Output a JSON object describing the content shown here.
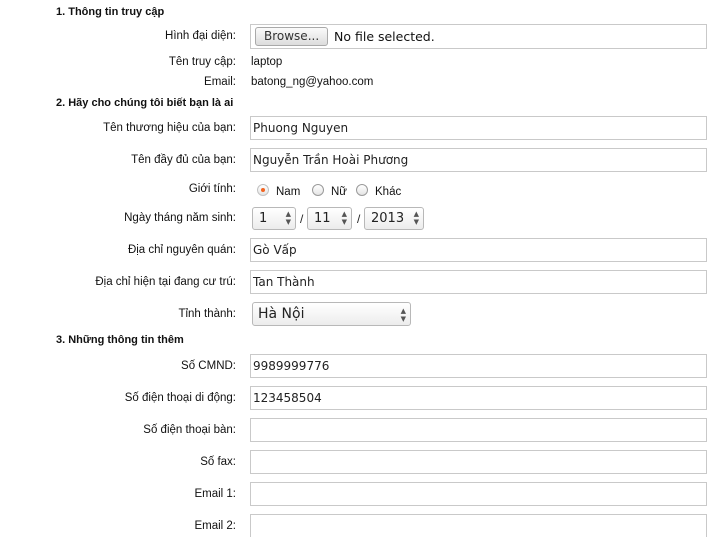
{
  "sections": {
    "access": "1. Thông tin truy cập",
    "about": "2. Hãy cho chúng tôi biết bạn là ai",
    "extra": "3. Những thông tin thêm"
  },
  "access": {
    "avatar_label": "Hình đại diện:",
    "browse_label": "Browse...",
    "file_status": "No file selected.",
    "username_label": "Tên truy cập:",
    "username_value": "laptop",
    "email_label": "Email:",
    "email_value": "batong_ng@yahoo.com"
  },
  "about": {
    "brand_label": "Tên thương hiệu của bạn:",
    "brand_value": "Phuong Nguyen",
    "fullname_label": "Tên đầy đủ của bạn:",
    "fullname_value": "Nguyễn Trần Hoài Phương",
    "gender_label": "Giới tính:",
    "gender_options": [
      "Nam",
      "Nữ",
      "Khác"
    ],
    "gender_selected": "Nam",
    "dob_label": "Ngày tháng năm sinh:",
    "dob_day": "1",
    "dob_month": "11",
    "dob_year": "2013",
    "dob_sep": "/",
    "hometown_label": "Địa chỉ nguyên quán:",
    "hometown_value": "Gò Vấp",
    "residence_label": "Địa chỉ hiện tại đang cư trú:",
    "residence_value": "Tan Thành",
    "province_label": "Tỉnh thành:",
    "province_value": "Hà Nội"
  },
  "extra": {
    "id_label": "Số CMND:",
    "id_value": "9989999776",
    "mobile_label": "Số điện thoại di động:",
    "mobile_value": "123458504",
    "phone_label": "Số điện thoại bàn:",
    "phone_value": "",
    "fax_label": "Số fax:",
    "fax_value": "",
    "email1_label": "Email 1:",
    "email1_value": "",
    "email2_label": "Email 2:",
    "email2_value": ""
  },
  "colors": {
    "radio_selected": "#f26522",
    "input_border": "#c9c9c9"
  }
}
